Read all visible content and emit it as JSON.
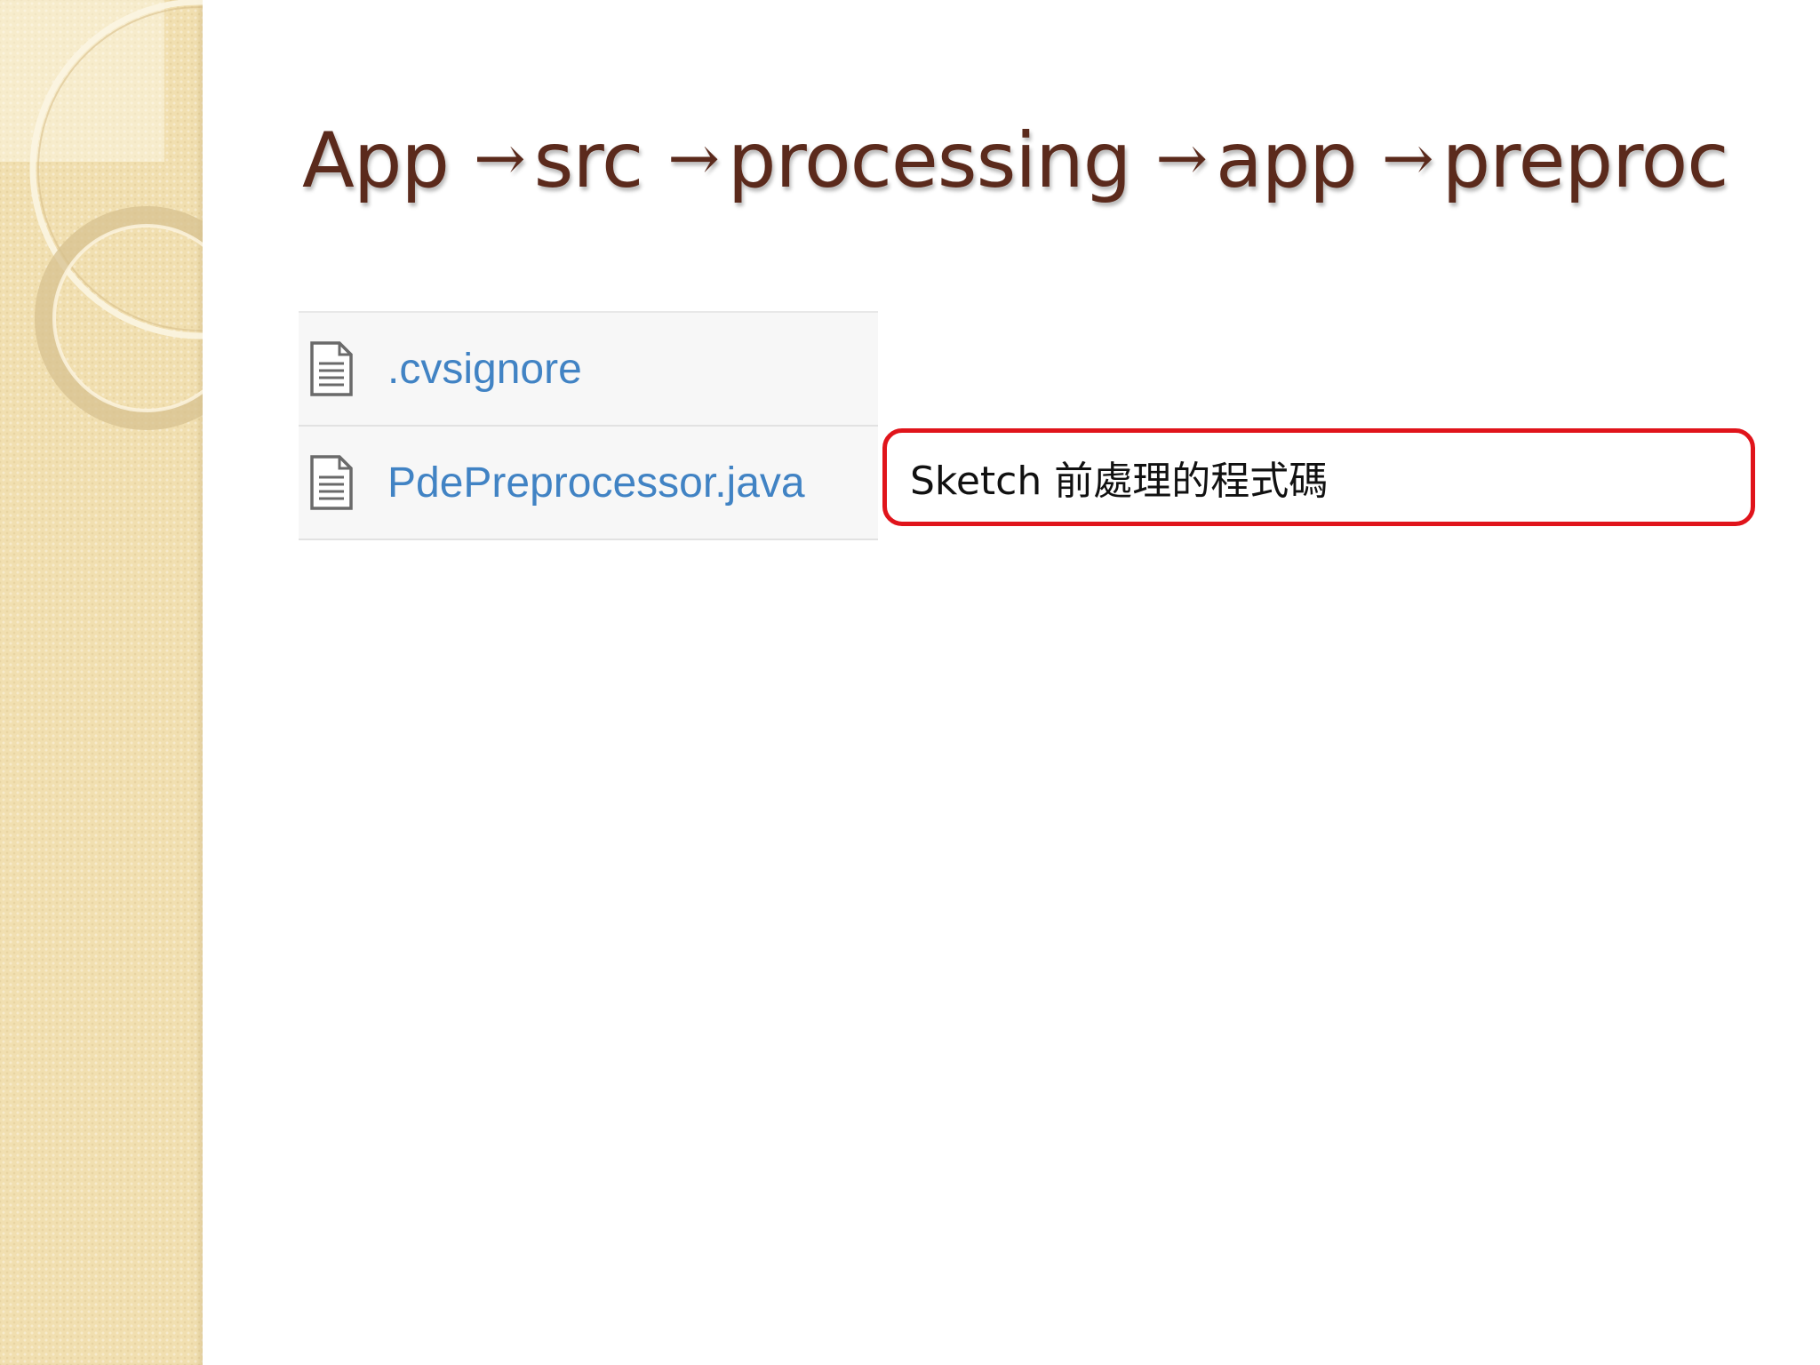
{
  "title": {
    "segments": [
      "App",
      "src",
      "processing",
      "app",
      "preproc"
    ],
    "separator": "→"
  },
  "files": [
    {
      "name": ".cvsignore",
      "icon": "file-text-icon"
    },
    {
      "name": "PdePreprocessor.java",
      "icon": "file-text-icon"
    }
  ],
  "callout": {
    "text": "Sketch 前處理的程式碼",
    "border_color": "#e0141b"
  },
  "colors": {
    "title": "#5b2a1c",
    "link": "#4183c4",
    "side_band": "#f1dfb0"
  }
}
